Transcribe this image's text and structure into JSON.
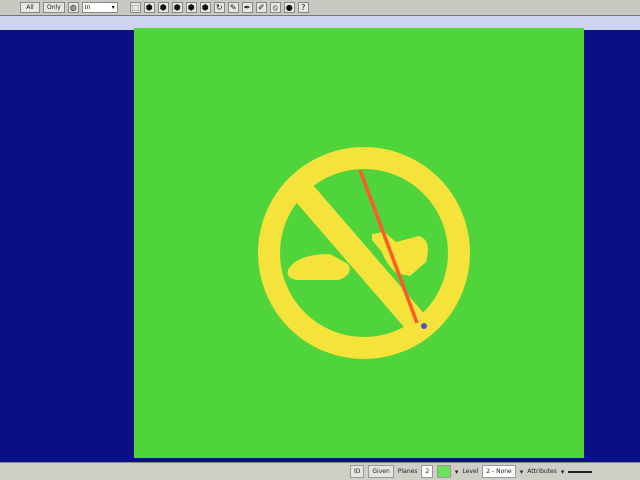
{
  "toolbar": {
    "all_label": "All",
    "only_label": "Only",
    "layer_select_value": "In",
    "icons": [
      "select-icon",
      "fill-icon",
      "cube-icon",
      "cube-icon",
      "cube-icon",
      "cube-icon",
      "rotate-icon",
      "paint-icon",
      "pen-icon",
      "edit-icon",
      "no-entry-icon",
      "circle-icon",
      "help-icon"
    ],
    "help_glyph": "?"
  },
  "statusbar": {
    "id_label": "ID",
    "given_label": "Given",
    "planes_label": "Planes",
    "planes_value": "2",
    "level_label": "Level",
    "level_value": "2 - None",
    "attributes_label": "Attributes"
  },
  "canvas": {
    "background_color": "#4fd43b",
    "sign_color": "#f5e23a",
    "needle_color": "#ff5a2a",
    "point_color": "#5a4fd0"
  }
}
